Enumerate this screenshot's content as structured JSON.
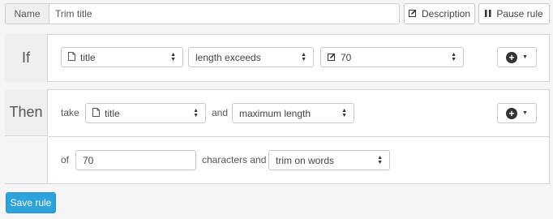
{
  "name_row": {
    "label": "Name",
    "value": "Trim title",
    "description_label": "Description",
    "pause_label": "Pause rule"
  },
  "if_section": {
    "label": "If",
    "field_select": "title",
    "condition_select": "length exceeds",
    "value_select": "70"
  },
  "then_section": {
    "label": "Then",
    "take_word": "take",
    "field_select": "title",
    "and_word": "and",
    "mode_select": "maximum length",
    "of_word": "of",
    "length_value": "70",
    "characters_and_word": "characters and",
    "trim_select": "trim on words"
  },
  "footer": {
    "save_label": "Save rule"
  },
  "colors": {
    "primary": "#2ea3db",
    "panel_bg": "#efefef"
  }
}
